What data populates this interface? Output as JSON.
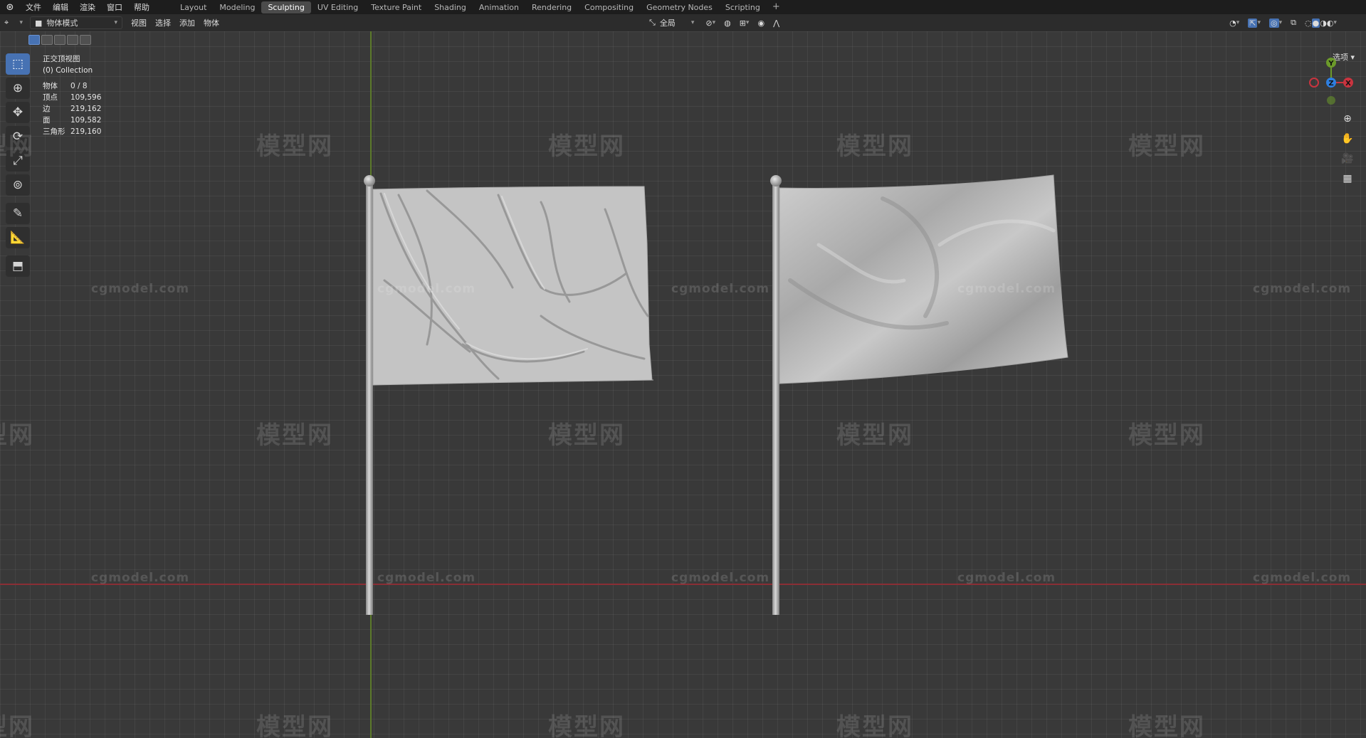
{
  "topbar": {
    "logo_icon": "blender-logo-icon",
    "menus": [
      "文件",
      "编辑",
      "渲染",
      "窗口",
      "帮助"
    ],
    "workspaces": [
      "Layout",
      "Modeling",
      "Sculpting",
      "UV Editing",
      "Texture Paint",
      "Shading",
      "Animation",
      "Rendering",
      "Compositing",
      "Geometry Nodes",
      "Scripting"
    ],
    "active_workspace": "Sculpting",
    "add_label": "+"
  },
  "header": {
    "mode": "物体模式",
    "menus": [
      "视图",
      "选择",
      "添加",
      "物体"
    ],
    "transform_orientation": "全局",
    "options_label": "选项"
  },
  "overlay": {
    "view_name": "正交顶视图",
    "collection": "(0) Collection",
    "stats": [
      {
        "label": "物体",
        "value": "0 / 8"
      },
      {
        "label": "顶点",
        "value": "109,596"
      },
      {
        "label": "边",
        "value": "219,162"
      },
      {
        "label": "面",
        "value": "109,582"
      },
      {
        "label": "三角形",
        "value": "219,160"
      }
    ]
  },
  "toolbar": {
    "tools": [
      "select-box-icon",
      "cursor-icon",
      "move-icon",
      "rotate-icon",
      "scale-icon",
      "transform-icon",
      "annotate-icon",
      "measure-icon",
      "add-cube-icon"
    ]
  },
  "gizmo": {
    "x": "X",
    "y": "Y",
    "z": "Z"
  },
  "watermarks": {
    "cn": "模型网",
    "en": "cgmodel.com"
  },
  "colors": {
    "accent": "#4772b3",
    "axis_x": "#c9343f",
    "axis_y": "#6c9a2a",
    "axis_z": "#2e7fe0",
    "viewport_bg": "#393939"
  }
}
